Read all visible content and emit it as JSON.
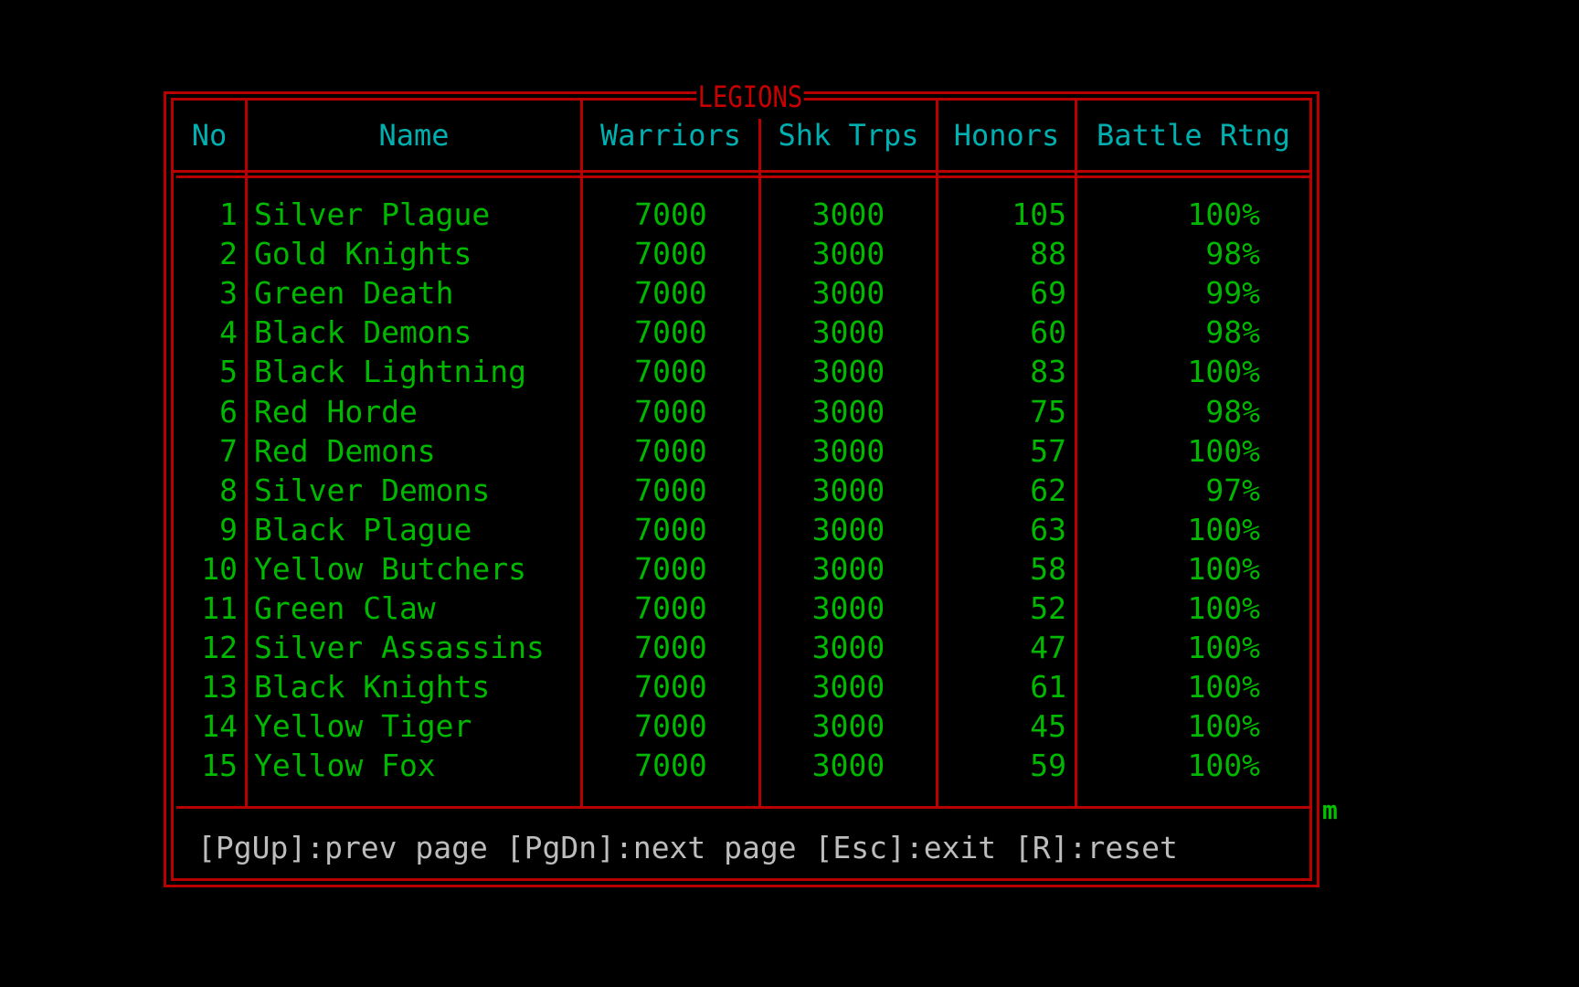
{
  "title": "LEGIONS",
  "columns": [
    "No",
    "Name",
    "Warriors",
    "Shk Trps",
    "Honors",
    "Battle Rtng"
  ],
  "rows": [
    {
      "no": "1",
      "name": "Silver Plague",
      "warriors": "7000",
      "shk_trps": "3000",
      "honors": "105",
      "battle_rtng": "100%"
    },
    {
      "no": "2",
      "name": "Gold Knights",
      "warriors": "7000",
      "shk_trps": "3000",
      "honors": "88",
      "battle_rtng": "98%"
    },
    {
      "no": "3",
      "name": "Green Death",
      "warriors": "7000",
      "shk_trps": "3000",
      "honors": "69",
      "battle_rtng": "99%"
    },
    {
      "no": "4",
      "name": "Black Demons",
      "warriors": "7000",
      "shk_trps": "3000",
      "honors": "60",
      "battle_rtng": "98%"
    },
    {
      "no": "5",
      "name": "Black Lightning",
      "warriors": "7000",
      "shk_trps": "3000",
      "honors": "83",
      "battle_rtng": "100%"
    },
    {
      "no": "6",
      "name": "Red Horde",
      "warriors": "7000",
      "shk_trps": "3000",
      "honors": "75",
      "battle_rtng": "98%"
    },
    {
      "no": "7",
      "name": "Red Demons",
      "warriors": "7000",
      "shk_trps": "3000",
      "honors": "57",
      "battle_rtng": "100%"
    },
    {
      "no": "8",
      "name": "Silver Demons",
      "warriors": "7000",
      "shk_trps": "3000",
      "honors": "62",
      "battle_rtng": "97%"
    },
    {
      "no": "9",
      "name": "Black Plague",
      "warriors": "7000",
      "shk_trps": "3000",
      "honors": "63",
      "battle_rtng": "100%"
    },
    {
      "no": "10",
      "name": "Yellow Butchers",
      "warriors": "7000",
      "shk_trps": "3000",
      "honors": "58",
      "battle_rtng": "100%"
    },
    {
      "no": "11",
      "name": "Green Claw",
      "warriors": "7000",
      "shk_trps": "3000",
      "honors": "52",
      "battle_rtng": "100%"
    },
    {
      "no": "12",
      "name": "Silver Assassins",
      "warriors": "7000",
      "shk_trps": "3000",
      "honors": "47",
      "battle_rtng": "100%"
    },
    {
      "no": "13",
      "name": "Black Knights",
      "warriors": "7000",
      "shk_trps": "3000",
      "honors": "61",
      "battle_rtng": "100%"
    },
    {
      "no": "14",
      "name": "Yellow Tiger",
      "warriors": "7000",
      "shk_trps": "3000",
      "honors": "45",
      "battle_rtng": "100%"
    },
    {
      "no": "15",
      "name": "Yellow Fox",
      "warriors": "7000",
      "shk_trps": "3000",
      "honors": "59",
      "battle_rtng": "100%"
    }
  ],
  "footer": "[PgUp]:prev page [PgDn]:next page [Esc]:exit [R]:reset",
  "stray_char": "m",
  "colors": {
    "frame": "#b80000",
    "title": "#c80000",
    "header": "#00b0b0",
    "data": "#00b800",
    "footer": "#bdbdbd"
  }
}
